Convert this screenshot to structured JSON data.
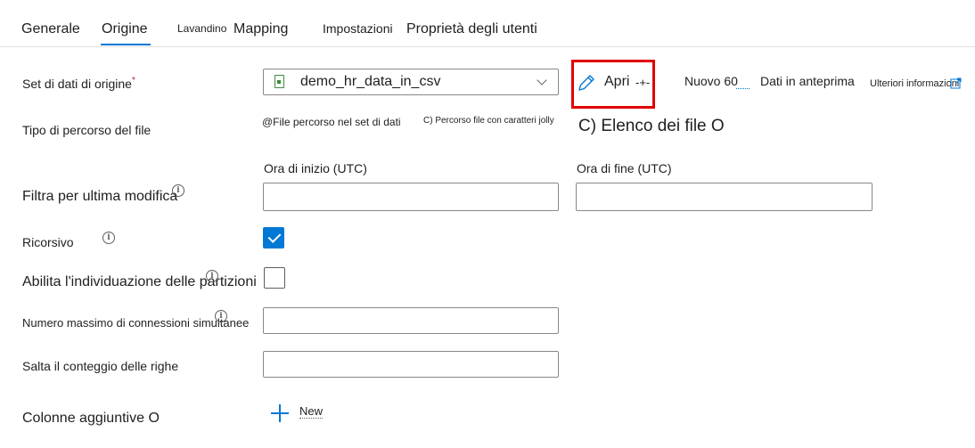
{
  "tabs": [
    {
      "label": "Generale"
    },
    {
      "label": "Origine",
      "active": true
    },
    {
      "label": "Lavandino"
    },
    {
      "label": "Mapping"
    },
    {
      "label": "Impostazioni"
    },
    {
      "label": "Proprietà degli utenti"
    }
  ],
  "source_dataset": {
    "label": "Set di dati di origine",
    "required_mark": "*",
    "value": "demo_hr_data_in_csv",
    "icon": "csv-dataset-icon"
  },
  "toolbar": {
    "open_label": "Apri",
    "open_suffix": "-+-",
    "new_label": "Nuovo 60",
    "preview_label": "Dati in anteprima",
    "more_info_label": "Ulteriori informazioni"
  },
  "file_path_type": {
    "label": "Tipo di percorso del file",
    "option_dataset": "@File percorso nel set di dati",
    "option_wildcard": "C) Percorso file con caratteri jolly",
    "option_list": "C) Elenco dei file O"
  },
  "filter_modified": {
    "label": "Filtra per ultima modifica",
    "start_label": "Ora di inizio (UTC)",
    "end_label": "Ora di fine (UTC)",
    "start_value": "",
    "end_value": ""
  },
  "recursive": {
    "label": "Ricorsivo",
    "checked": true
  },
  "partition_discovery": {
    "label": "Abilita l'individuazione delle partizioni",
    "checked": false
  },
  "max_connections": {
    "label": "Numero massimo di connessioni simultanee",
    "value": ""
  },
  "skip_line_count": {
    "label": "Salta il conteggio delle righe",
    "value": ""
  },
  "additional_columns": {
    "label": "Colonne aggiuntive O",
    "new_label": "New"
  },
  "colors": {
    "accent": "#0078d4",
    "highlight": "#e00000",
    "required": "#a4262c"
  }
}
